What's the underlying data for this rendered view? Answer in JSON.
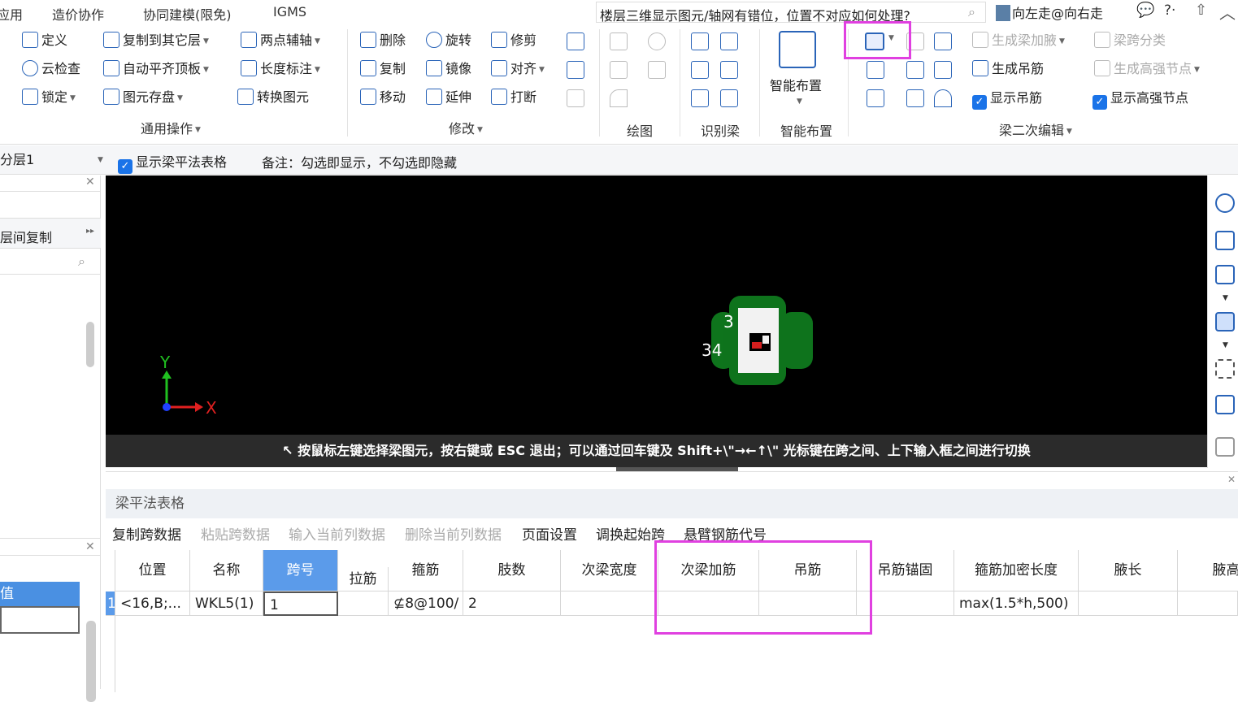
{
  "menu": {
    "items": [
      "应用",
      "造价协作",
      "协同建模(限免)",
      "IGMS"
    ],
    "search_text": "楼层三维显示图元/轴网有错位，位置不对应如何处理?",
    "user": "向左走@向右走",
    "right_icons": "?·"
  },
  "ribbon": {
    "common": {
      "define": "定义",
      "copy_layer": "复制到其它层",
      "two_point_axis": "两点辅轴",
      "cloud_check": "云检查",
      "auto_align": "自动平齐顶板",
      "length_mark": "长度标注",
      "lock": "锁定",
      "save_elem": "图元存盘",
      "convert": "转换图元",
      "label": "通用操作"
    },
    "modify": {
      "delete": "删除",
      "rotate": "旋转",
      "trim": "修剪",
      "copy": "复制",
      "mirror": "镜像",
      "align": "对齐",
      "move": "移动",
      "extend": "延伸",
      "break": "打断",
      "label": "修改"
    },
    "draw_label": "绘图",
    "identify_label": "识别梁",
    "smart": {
      "button": "智能布置",
      "label": "智能布置"
    },
    "beam2": {
      "gen_haunch": "生成梁加腋",
      "span_class": "梁跨分类",
      "gen_hanger": "生成吊筋",
      "gen_node": "生成高强节点",
      "show_hanger": "显示吊筋",
      "show_node": "显示高强节点",
      "label": "梁二次编辑"
    }
  },
  "options": {
    "layer": "分层1",
    "show_table": "显示梁平法表格",
    "note": "备注：勾选即显示，不勾选即隐藏"
  },
  "left": {
    "copy_label": "层间复制",
    "value_label": "值"
  },
  "canvas": {
    "axis_x": "X",
    "axis_y": "Y",
    "label_3": "3",
    "label_34": "34"
  },
  "status": "按鼠标左键选择梁图元，按右键或 ESC 退出；可以通过回车键及 Shift+\\\"→←↑\\\" 光标键在跨之间、上下输入框之间进行切换",
  "table_panel": {
    "title": "梁平法表格",
    "toolbar": [
      "复制跨数据",
      "粘贴跨数据",
      "输入当前列数据",
      "删除当前列数据",
      "页面设置",
      "调换起始跨",
      "悬臂钢筋代号"
    ],
    "headers": [
      "位置",
      "名称",
      "跨号",
      "拉筋",
      "箍筋",
      "肢数",
      "次梁宽度",
      "次梁加筋",
      "吊筋",
      "吊筋锚固",
      "箍筋加密长度",
      "腋长",
      "腋高"
    ],
    "row": {
      "index": "1",
      "position": "<16,B;...",
      "name": "WKL5(1)",
      "span": "1",
      "stirrup": "⊈8@100/",
      "legs": "2",
      "dense_len": "max(1.5*h,500)"
    }
  },
  "colors": {
    "accent": "#1a73e8",
    "highlight": "#e040e0",
    "status_bg": "#2b2b2b"
  }
}
